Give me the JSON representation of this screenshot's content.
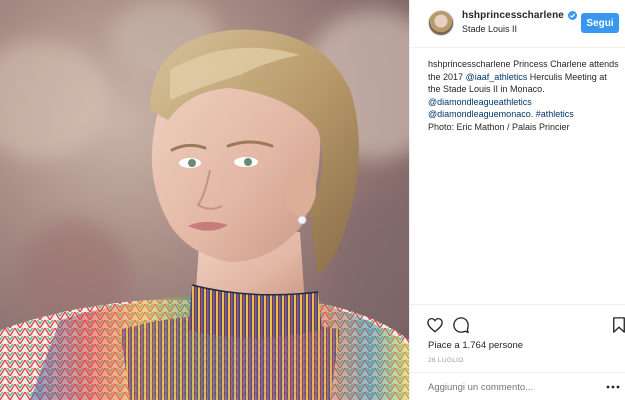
{
  "post": {
    "photo_alt": "",
    "username": "hshprincesscharlene",
    "verified": true,
    "location": "Stade Louis II",
    "follow_label": "Segui",
    "caption": {
      "author": "hshprincesscharlene",
      "line1": "Princess Charlene attends the 2017",
      "mention1": "@iaaf_athletics",
      "line2": "Herculis Meeting at the Stade Louis II in Monaco.",
      "mention2": "@diamondleagueathletics",
      "mention3": "@diamondleaguemonaco.",
      "hashtag": "#athletics",
      "credit": "Photo: Eric Mathon / Palais Princier"
    },
    "likes_text": "Piace a 1.764 persone",
    "date_text": "26 LUGLIO",
    "comment_placeholder": "Aggiungi un commento...",
    "icons": [
      "heart-icon",
      "comment-icon",
      "bookmark-icon",
      "more-dots-icon",
      "verified-badge-icon"
    ],
    "colors": {
      "accent": "#3897f0",
      "link": "#003569",
      "border": "#efefef",
      "muted": "#999999"
    }
  }
}
